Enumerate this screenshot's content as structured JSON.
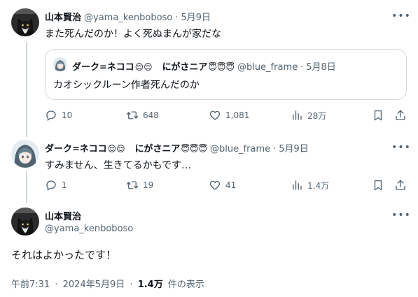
{
  "tweet1": {
    "name": "山本賢治",
    "handle": "@yama_kenboboso",
    "dot": "·",
    "date": "5月9日",
    "text": "また死んだのか！よく死ぬまんが家だな",
    "quote": {
      "name": "ダーク=ネココ",
      "name2": "にがさニア",
      "handle": "@blue_frame",
      "dot": "·",
      "date": "5月8日",
      "text": "カオシックルーン作者死んだのか"
    },
    "actions": {
      "replies": "10",
      "retweets": "648",
      "likes": "1,081",
      "views": "28万"
    }
  },
  "tweet2": {
    "name": "ダーク=ネココ",
    "name2": "にがさニア",
    "handle": "@blue_frame",
    "dot": "·",
    "date": "5月9日",
    "text": "すみません、生きてるかもです…",
    "actions": {
      "replies": "1",
      "retweets": "19",
      "likes": "41",
      "views": "1.4万"
    }
  },
  "main": {
    "name": "山本賢治",
    "handle": "@yama_kenboboso",
    "text": "それはよかったです！",
    "time": "午前7:31",
    "dot1": "·",
    "date": "2024年5月9日",
    "dot2": "·",
    "views_count": "1.4万",
    "views_label": "件の表示"
  },
  "icons": {
    "more": "more-icon",
    "reply": "reply-icon",
    "retweet": "retweet-icon",
    "like": "like-icon",
    "views": "views-icon",
    "bookmark": "bookmark-icon",
    "share": "share-icon"
  },
  "colors": {
    "secondary_text": "#536471",
    "border": "#cfd9de",
    "text": "#0f1419"
  }
}
